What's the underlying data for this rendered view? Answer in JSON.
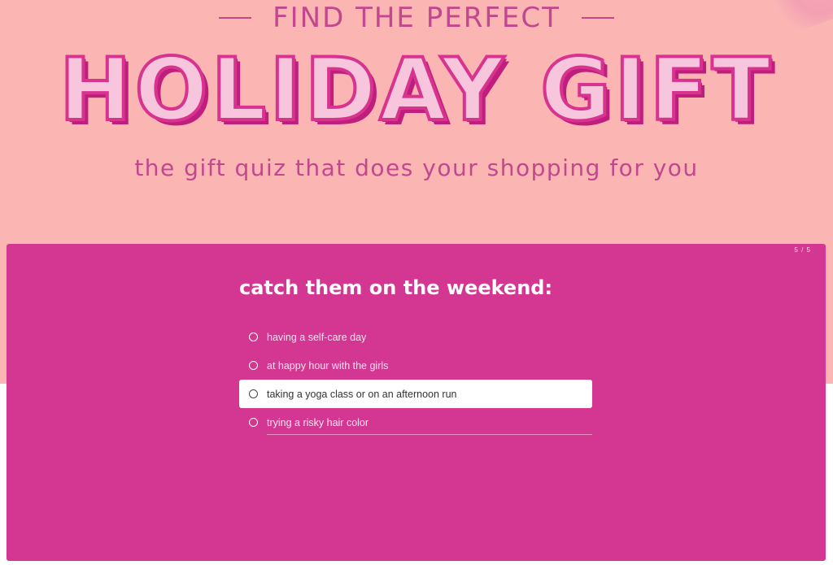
{
  "hero": {
    "kicker": "FIND THE PERFECT",
    "headline": "HOLIDAY GIFT",
    "subtitle": "the gift quiz that does your shopping for you"
  },
  "quiz": {
    "progress": "5 / 5",
    "question": "catch them on the weekend:",
    "options": [
      {
        "label": "having a self-care day",
        "selected": false
      },
      {
        "label": "at happy hour with the girls",
        "selected": false
      },
      {
        "label": "taking a yoga class or on an afternoon run",
        "selected": true
      },
      {
        "label": "trying a risky hair color",
        "selected": false
      }
    ]
  },
  "colors": {
    "hero_bg": "#fbb6b4",
    "panel_bg": "#d43791",
    "accent_text": "#c2478e"
  }
}
